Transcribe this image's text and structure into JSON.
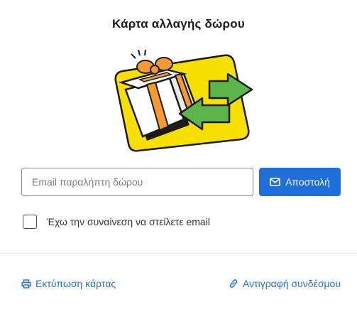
{
  "title": "Κάρτα αλλαγής δώρου",
  "illustration": {
    "icon": "gift-exchange-icon",
    "colors": {
      "card": "#f7e000",
      "bow": "#f59a2e",
      "arrows": "#5bb54a",
      "outline": "#1b1b1b"
    }
  },
  "email": {
    "placeholder": "Email παραλήπτη δώρου",
    "value": ""
  },
  "send_button": {
    "label": "Αποστολή",
    "icon": "mail-icon"
  },
  "consent": {
    "label": "Έχω την συναίνεση να στείλετε email",
    "checked": false
  },
  "actions": {
    "print": {
      "label": "Εκτύπωση κάρτας",
      "icon": "printer-icon"
    },
    "copy": {
      "label": "Αντιγραφή συνδέσμου",
      "icon": "link-icon"
    }
  },
  "colors": {
    "accent": "#1e6fd9"
  }
}
